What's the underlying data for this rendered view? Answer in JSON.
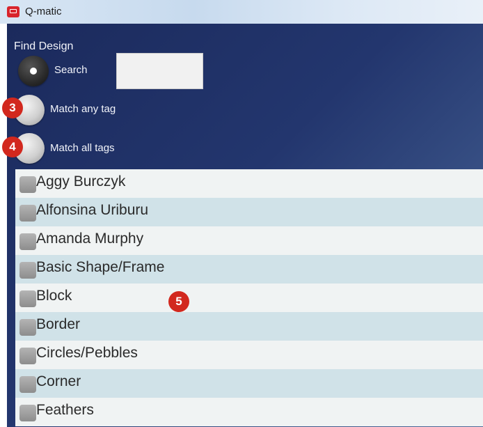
{
  "window": {
    "title": "Q-matic"
  },
  "find": {
    "label": "Find Design",
    "options": [
      {
        "label": "Search",
        "selected": true
      },
      {
        "label": "Match any tag",
        "selected": false
      },
      {
        "label": "Match all tags",
        "selected": false
      }
    ],
    "search_value": ""
  },
  "callouts": [
    "3",
    "4",
    "5"
  ],
  "tags": [
    "Aggy Burczyk",
    "Alfonsina Uriburu",
    "Amanda Murphy",
    "Basic Shape/Frame",
    "Block",
    "Border",
    "Circles/Pebbles",
    "Corner",
    "Feathers"
  ],
  "colors": {
    "accent": "#d2281e",
    "panel": "#23366e",
    "row_alt": "#d0e2e8"
  }
}
